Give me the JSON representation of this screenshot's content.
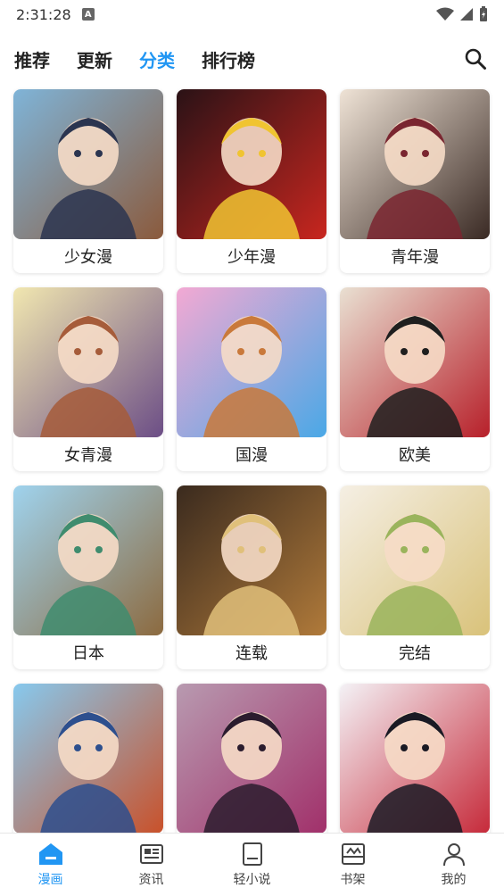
{
  "status_bar": {
    "time": "2:31:28",
    "a_badge": "A"
  },
  "top_nav": {
    "tabs": [
      {
        "label": "推荐",
        "active": false
      },
      {
        "label": "更新",
        "active": false
      },
      {
        "label": "分类",
        "active": true
      },
      {
        "label": "排行榜",
        "active": false
      }
    ],
    "search_icon": "search-icon"
  },
  "categories": [
    {
      "label": "少女漫",
      "palette": [
        "#7fb4d8",
        "#8b5a3c",
        "#2b3550"
      ]
    },
    {
      "label": "少年漫",
      "palette": [
        "#2a1216",
        "#c8261f",
        "#f0c431"
      ]
    },
    {
      "label": "青年漫",
      "palette": [
        "#efe3d6",
        "#3a2a24",
        "#7a2630"
      ]
    },
    {
      "label": "女青漫",
      "palette": [
        "#f1e7b0",
        "#6c4e86",
        "#a65c3a"
      ]
    },
    {
      "label": "国漫",
      "palette": [
        "#f3a9d3",
        "#4aa8e6",
        "#c9793b"
      ]
    },
    {
      "label": "欧美",
      "palette": [
        "#e9e0d2",
        "#b7202a",
        "#1f1f1f"
      ]
    },
    {
      "label": "日本",
      "palette": [
        "#9fd3ee",
        "#8c6a3f",
        "#3f8c6e"
      ]
    },
    {
      "label": "连载",
      "palette": [
        "#3a2a1e",
        "#b07a3a",
        "#e0c07a"
      ]
    },
    {
      "label": "完结",
      "palette": [
        "#f5efe4",
        "#d9c27a",
        "#9ab45c"
      ]
    },
    {
      "label": "",
      "palette": [
        "#87c9ee",
        "#c9512a",
        "#2d4f8e"
      ]
    },
    {
      "label": "",
      "palette": [
        "#b89ab0",
        "#a1306a",
        "#2b1c2e"
      ]
    },
    {
      "label": "",
      "palette": [
        "#f4f2f6",
        "#c62a3a",
        "#1a1a24"
      ]
    }
  ],
  "bottom_nav": [
    {
      "label": "漫画",
      "icon": "home-icon",
      "active": true
    },
    {
      "label": "资讯",
      "icon": "news-icon",
      "active": false
    },
    {
      "label": "轻小说",
      "icon": "book-icon",
      "active": false
    },
    {
      "label": "书架",
      "icon": "bookshelf-icon",
      "active": false
    },
    {
      "label": "我的",
      "icon": "profile-icon",
      "active": false
    }
  ],
  "colors": {
    "accent": "#2196f3",
    "text": "#222222"
  }
}
